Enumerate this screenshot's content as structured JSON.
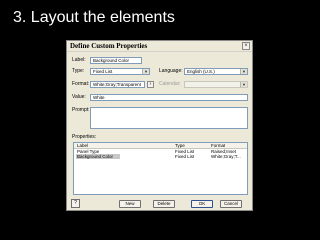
{
  "slide": {
    "title": "3. Layout the elements"
  },
  "dialog": {
    "title": "Define Custom Properties",
    "close_glyph": "×",
    "label": {
      "caption": "Label:",
      "value": "Background Color"
    },
    "type": {
      "caption": "Type:",
      "value": "Fixed List"
    },
    "language": {
      "caption": "Language:",
      "value": "English (U.S.)"
    },
    "format": {
      "caption": "Format:",
      "value": "White;Gray;Transparent",
      "browse_glyph": "›"
    },
    "calendar": {
      "caption": "Calendar:",
      "value": ""
    },
    "value": {
      "caption": "Value:",
      "value": "White"
    },
    "prompt": {
      "caption": "Prompt:",
      "value": ""
    },
    "properties": {
      "caption": "Properties:",
      "columns": [
        "Label",
        "Type",
        "Format"
      ],
      "rows": [
        {
          "label": "Panel Type",
          "type": "Fixed List",
          "format": "Raised;Inset",
          "selected": false
        },
        {
          "label": "Background Color",
          "type": "Fixed List",
          "format": "White;Gray;T...",
          "selected": true
        }
      ]
    },
    "buttons": {
      "new": "New",
      "delete": "Delete",
      "ok": "OK",
      "cancel": "Cancel"
    },
    "help_icon_glyph": "?"
  }
}
